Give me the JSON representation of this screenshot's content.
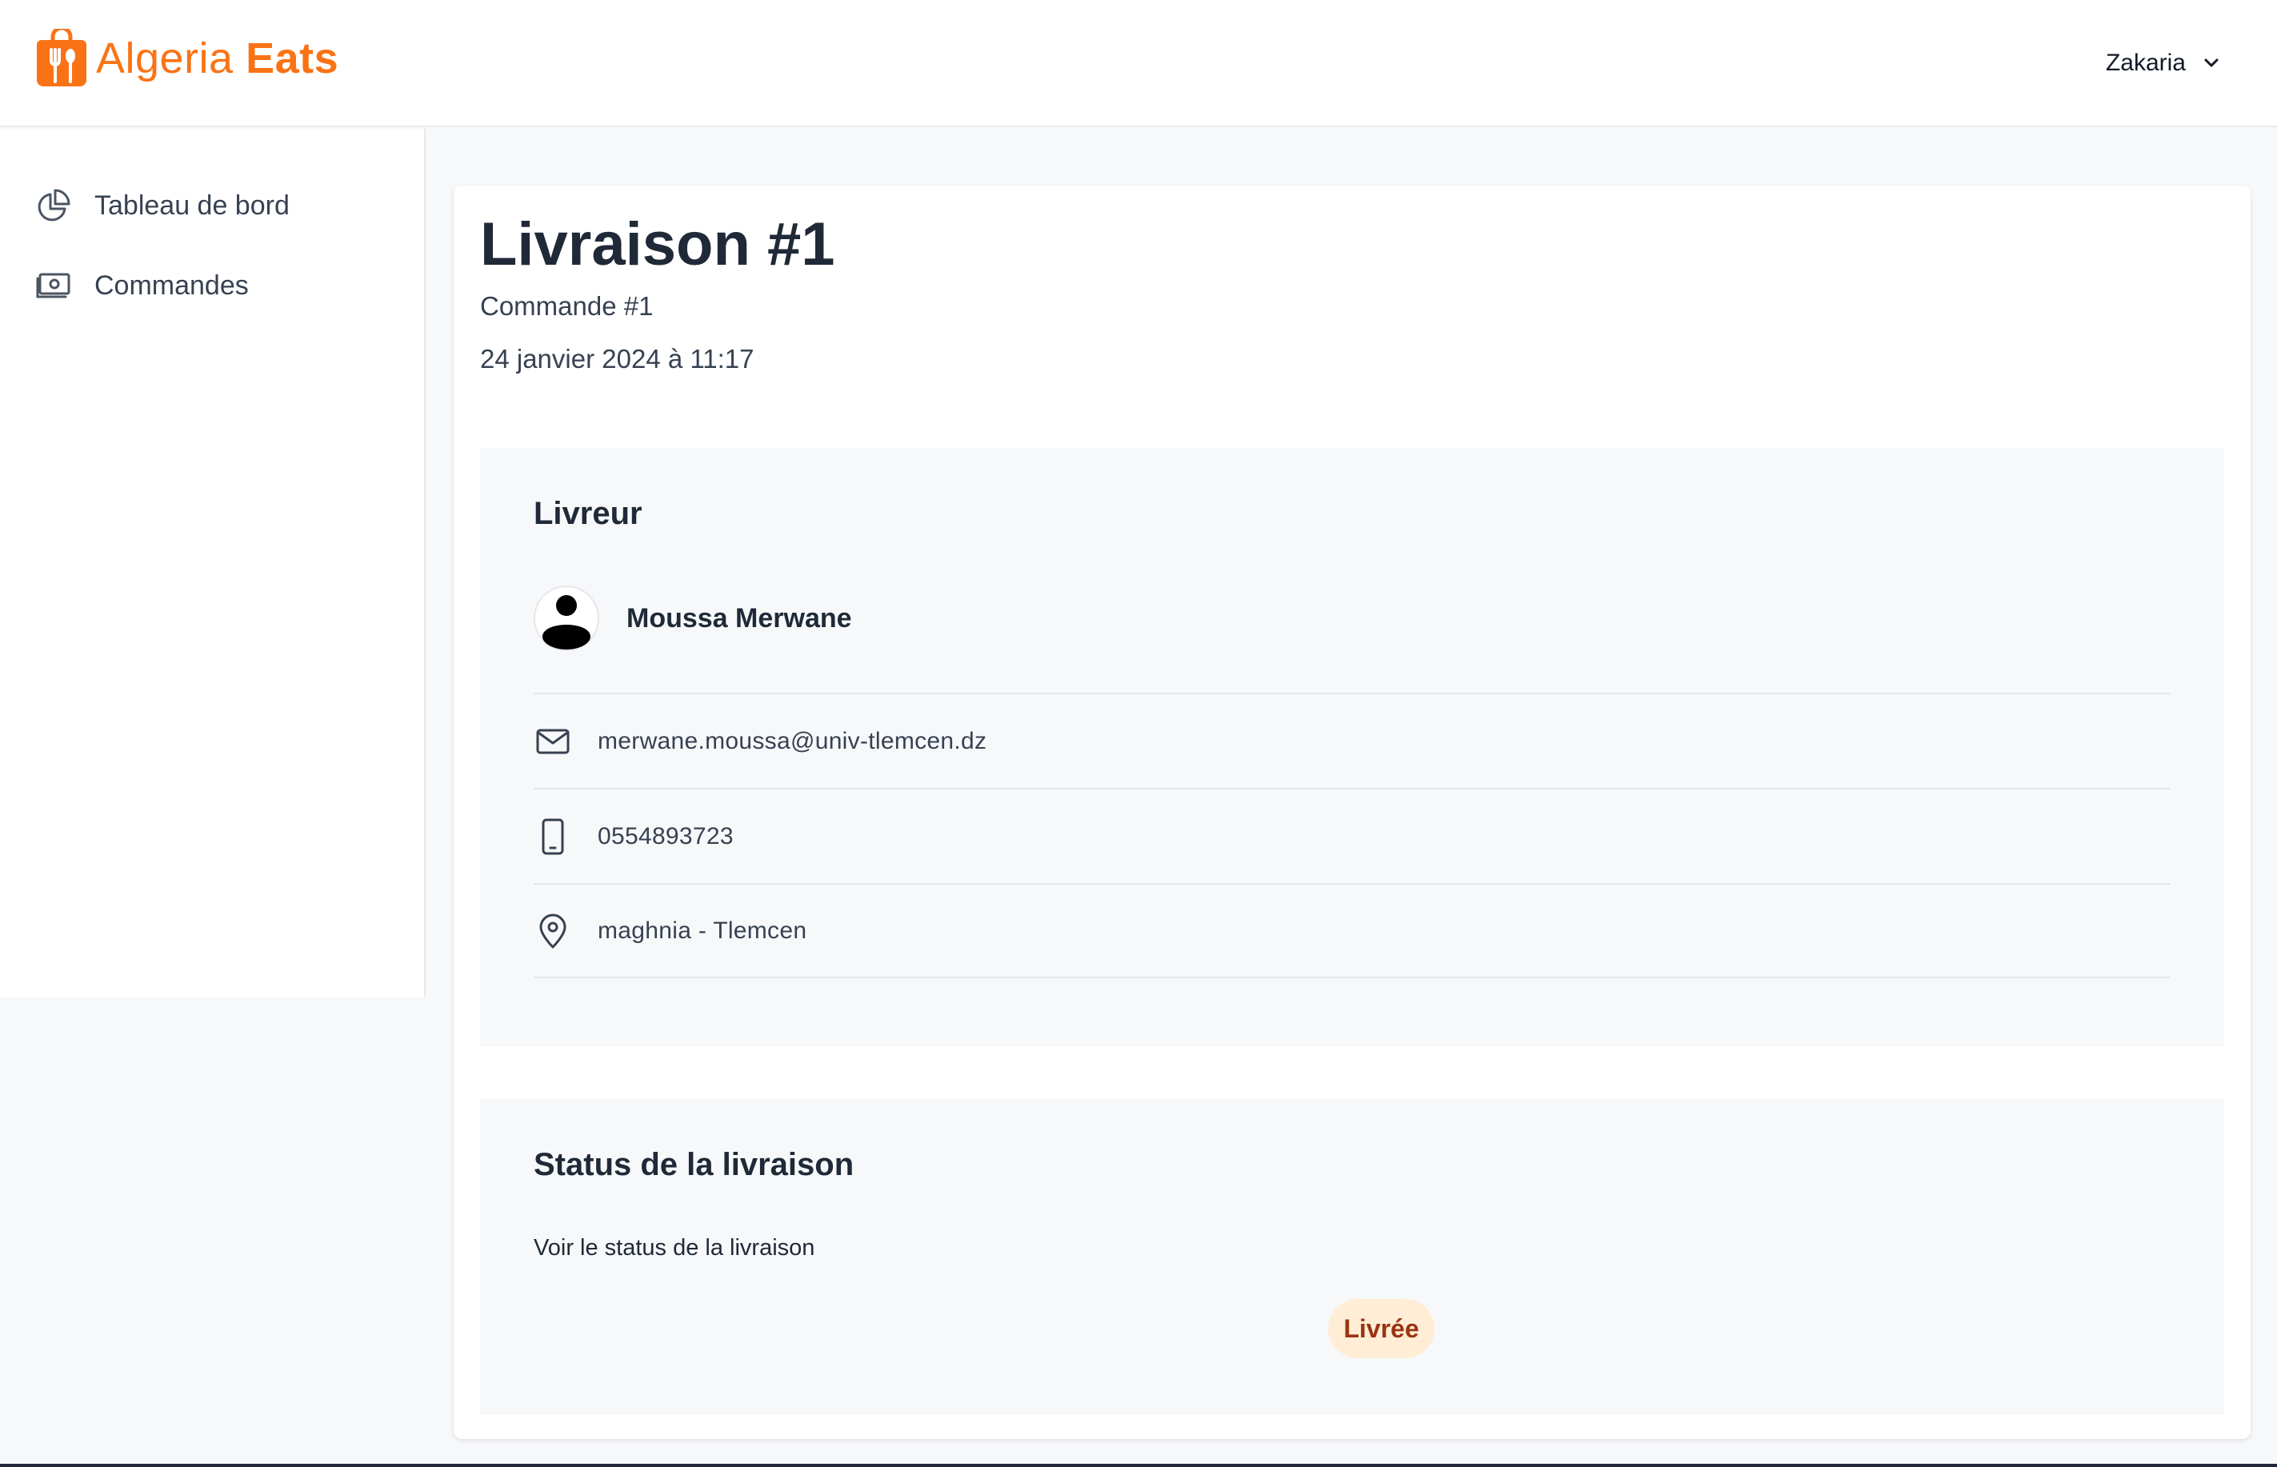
{
  "brand": {
    "name_part1": "Algeria ",
    "name_part2": "Eats",
    "color": "#f97316",
    "icon": "fork-knife-bag-icon"
  },
  "header": {
    "user_name": "Zakaria",
    "user_menu_icon": "chevron-down-icon"
  },
  "sidebar": {
    "items": [
      {
        "label": "Tableau de bord",
        "icon": "pie-chart-icon"
      },
      {
        "label": "Commandes",
        "icon": "banknote-icon"
      }
    ]
  },
  "page": {
    "title": "Livraison #1",
    "order_ref": "Commande #1",
    "datetime": "24 janvier 2024 à 11:17"
  },
  "livreur": {
    "section_title": "Livreur",
    "name": "Moussa Merwane",
    "email": "merwane.moussa@univ-tlemcen.dz",
    "phone": "0554893723",
    "location": "maghnia - Tlemcen"
  },
  "status": {
    "section_title": "Status de la livraison",
    "description": "Voir le status de la livraison",
    "badge_label": "Livrée",
    "badge_bg": "#ffedd5",
    "badge_text_color": "#9a3412"
  }
}
